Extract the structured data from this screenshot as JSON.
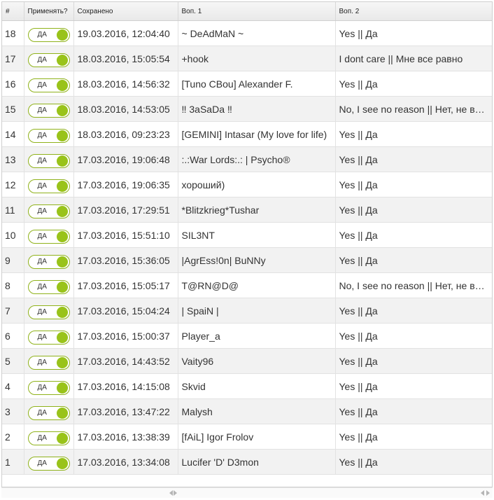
{
  "columns": {
    "num": "#",
    "apply": "Применять?",
    "saved": "Сохранено",
    "q1": "Воп. 1",
    "q2": "Воп. 2"
  },
  "toggle_label": "ДА",
  "rows": [
    {
      "num": "18",
      "saved": "19.03.2016, 12:04:40",
      "q1": "~ DeAdMaN ~",
      "q2": "Yes || Да"
    },
    {
      "num": "17",
      "saved": "18.03.2016, 15:05:54",
      "q1": "+hook",
      "q2": "I dont care || Мне все равно"
    },
    {
      "num": "16",
      "saved": "18.03.2016, 14:56:32",
      "q1": "[Tuno CBou] Alexander F.",
      "q2": "Yes || Да"
    },
    {
      "num": "15",
      "saved": "18.03.2016, 14:53:05",
      "q1": "‼ 3aSaDa ‼",
      "q2": "No, I see no reason || Нет, не вижу смысла"
    },
    {
      "num": "14",
      "saved": "18.03.2016, 09:23:23",
      "q1": "[GEMINI] Intasar (My love for life)",
      "q2": "Yes || Да"
    },
    {
      "num": "13",
      "saved": "17.03.2016, 19:06:48",
      "q1": ":.:War Lords:.: | Psycho®",
      "q2": "Yes || Да"
    },
    {
      "num": "12",
      "saved": "17.03.2016, 19:06:35",
      "q1": "хороший)",
      "q2": "Yes || Да"
    },
    {
      "num": "11",
      "saved": "17.03.2016, 17:29:51",
      "q1": "*Blitzkrieg*Tushar",
      "q2": "Yes || Да"
    },
    {
      "num": "10",
      "saved": "17.03.2016, 15:51:10",
      "q1": "SIL3NT",
      "q2": "Yes || Да"
    },
    {
      "num": "9",
      "saved": "17.03.2016, 15:36:05",
      "q1": "|AgrEss!0n| BuNNy",
      "q2": "Yes || Да"
    },
    {
      "num": "8",
      "saved": "17.03.2016, 15:05:17",
      "q1": "T@RN@D@",
      "q2": "No, I see no reason || Нет, не вижу смысла"
    },
    {
      "num": "7",
      "saved": "17.03.2016, 15:04:24",
      "q1": "| SpaiN |",
      "q2": "Yes || Да"
    },
    {
      "num": "6",
      "saved": "17.03.2016, 15:00:37",
      "q1": "Player_a",
      "q2": "Yes || Да"
    },
    {
      "num": "5",
      "saved": "17.03.2016, 14:43:52",
      "q1": "Vaity96",
      "q2": "Yes || Да"
    },
    {
      "num": "4",
      "saved": "17.03.2016, 14:15:08",
      "q1": "Skvid",
      "q2": "Yes || Да"
    },
    {
      "num": "3",
      "saved": "17.03.2016, 13:47:22",
      "q1": "Malysh",
      "q2": "Yes || Да"
    },
    {
      "num": "2",
      "saved": "17.03.2016, 13:38:39",
      "q1": "[fAiL] Igor Frolov",
      "q2": "Yes || Да"
    },
    {
      "num": "1",
      "saved": "17.03.2016, 13:34:08",
      "q1": "Lucifer 'D' D3mon",
      "q2": "Yes || Да"
    }
  ],
  "icons": {
    "scroll_left": "chevron-left-icon",
    "scroll_right": "chevron-right-icon"
  },
  "colors": {
    "toggle_on": "#99c31a",
    "toggle_border": "#8fb21a",
    "row_alt": "#f2f2f2"
  }
}
